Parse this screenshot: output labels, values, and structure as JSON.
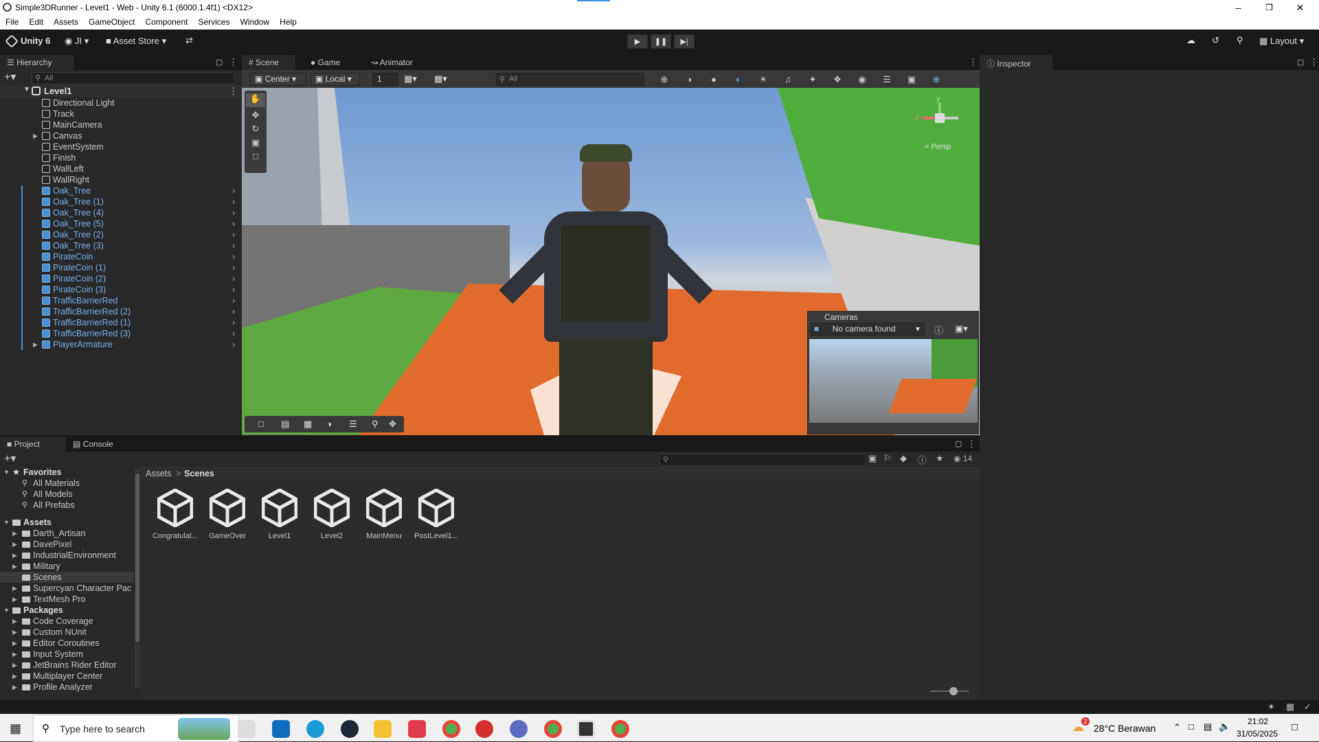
{
  "window": {
    "title": "Simple3DRunner - Level1 - Web - Unity 6.1 (6000.1.4f1) <DX12>"
  },
  "menu": [
    "File",
    "Edit",
    "Assets",
    "GameObject",
    "Component",
    "Services",
    "Window",
    "Help"
  ],
  "toolbar": {
    "brand": "Unity 6",
    "account": "JI",
    "asset_store": "Asset Store",
    "layout": "Layout"
  },
  "hierarchy": {
    "tab": "Hierarchy",
    "search_placeholder": "All",
    "scene": "Level1",
    "items": [
      {
        "name": "Directional Light",
        "prefab": false,
        "expandable": false
      },
      {
        "name": "Track",
        "prefab": false,
        "expandable": false
      },
      {
        "name": "MainCamera",
        "prefab": false,
        "expandable": false
      },
      {
        "name": "Canvas",
        "prefab": false,
        "expandable": true
      },
      {
        "name": "EventSystem",
        "prefab": false,
        "expandable": false
      },
      {
        "name": "Finish",
        "prefab": false,
        "expandable": false
      },
      {
        "name": "WallLeft",
        "prefab": false,
        "expandable": false
      },
      {
        "name": "WallRight",
        "prefab": false,
        "expandable": false
      },
      {
        "name": "Oak_Tree",
        "prefab": true,
        "expandable": false
      },
      {
        "name": "Oak_Tree (1)",
        "prefab": true,
        "expandable": false
      },
      {
        "name": "Oak_Tree (4)",
        "prefab": true,
        "expandable": false
      },
      {
        "name": "Oak_Tree (5)",
        "prefab": true,
        "expandable": false
      },
      {
        "name": "Oak_Tree (2)",
        "prefab": true,
        "expandable": false
      },
      {
        "name": "Oak_Tree (3)",
        "prefab": true,
        "expandable": false
      },
      {
        "name": "PirateCoin",
        "prefab": true,
        "expandable": false
      },
      {
        "name": "PirateCoin (1)",
        "prefab": true,
        "expandable": false
      },
      {
        "name": "PirateCoin (2)",
        "prefab": true,
        "expandable": false
      },
      {
        "name": "PirateCoin (3)",
        "prefab": true,
        "expandable": false
      },
      {
        "name": "TrafficBarrierRed",
        "prefab": true,
        "expandable": false
      },
      {
        "name": "TrafficBarrierRed (2)",
        "prefab": true,
        "expandable": false
      },
      {
        "name": "TrafficBarrierRed (1)",
        "prefab": true,
        "expandable": false
      },
      {
        "name": "TrafficBarrierRed (3)",
        "prefab": true,
        "expandable": false
      },
      {
        "name": "PlayerArmature",
        "prefab": true,
        "expandable": true
      }
    ]
  },
  "scene_tabs": [
    "Scene",
    "Game",
    "Animator"
  ],
  "scene_toolbar": {
    "pivot": "Center",
    "space": "Local",
    "grid_value": "1",
    "search_placeholder": "All"
  },
  "gizmo": {
    "y": "y",
    "x": "x",
    "persp": "< Persp"
  },
  "cameras_overlay": {
    "title": "Cameras",
    "selection": "No camera found"
  },
  "inspector": {
    "tab": "Inspector"
  },
  "project": {
    "tabs": [
      "Project",
      "Console"
    ],
    "badge": "14",
    "favorites": {
      "label": "Favorites",
      "items": [
        "All Materials",
        "All Models",
        "All Prefabs"
      ]
    },
    "assets": {
      "label": "Assets",
      "items": [
        "Darth_Artisan",
        "DavePixel",
        "IndustrialEnvironment",
        "Military",
        "Scenes",
        "Supercyan Character Pac",
        "TextMesh Pro"
      ]
    },
    "packages": {
      "label": "Packages",
      "items": [
        "Code Coverage",
        "Custom NUnit",
        "Editor Coroutines",
        "Input System",
        "JetBrains Rider Editor",
        "Multiplayer Center",
        "Profile Analyzer"
      ]
    },
    "breadcrumb": [
      "Assets",
      "Scenes"
    ],
    "scenes": [
      "Congratulat...",
      "GameOver",
      "Level1",
      "Level2",
      "MainMenu",
      "PostLevel1..."
    ]
  },
  "taskbar": {
    "search_placeholder": "Type here to search",
    "weather": "28°C Berawan",
    "time": "21:02",
    "date": "31/05/2025",
    "weather_badge": "2"
  },
  "colors": {
    "accent": "#4a8fd1",
    "prefab_text": "#7ab2ec",
    "editor_bg": "#282828",
    "selected": "#3e5f8a"
  }
}
